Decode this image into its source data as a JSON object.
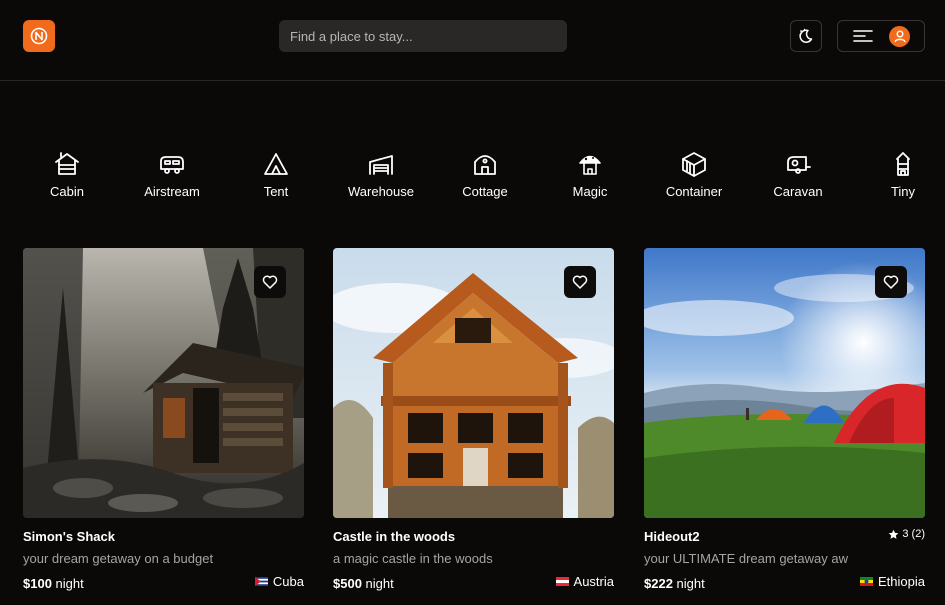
{
  "header": {
    "search_placeholder": "Find a place to stay...",
    "brand_color": "#f26a1b"
  },
  "categories": [
    {
      "label": "Cabin",
      "icon": "cabin-icon"
    },
    {
      "label": "Airstream",
      "icon": "airstream-icon"
    },
    {
      "label": "Tent",
      "icon": "tent-icon"
    },
    {
      "label": "Warehouse",
      "icon": "warehouse-icon"
    },
    {
      "label": "Cottage",
      "icon": "cottage-icon"
    },
    {
      "label": "Magic",
      "icon": "magic-icon"
    },
    {
      "label": "Container",
      "icon": "container-icon"
    },
    {
      "label": "Caravan",
      "icon": "caravan-icon"
    },
    {
      "label": "Tiny",
      "icon": "tiny-icon"
    }
  ],
  "listings": [
    {
      "title": "Simon's Shack",
      "description": "your dream getaway on a budget",
      "price": "$100",
      "price_unit": "night",
      "country": "Cuba",
      "flag": "cuba-flag"
    },
    {
      "title": "Castle in the woods",
      "description": "a magic castle in the woods",
      "price": "$500",
      "price_unit": "night",
      "country": "Austria",
      "flag": "austria-flag"
    },
    {
      "title": "Hideout2",
      "description": "your ULTIMATE dream getaway aw",
      "price": "$222",
      "price_unit": "night",
      "country": "Ethiopia",
      "flag": "ethiopia-flag",
      "rating": "3",
      "reviews": "(2)"
    }
  ]
}
